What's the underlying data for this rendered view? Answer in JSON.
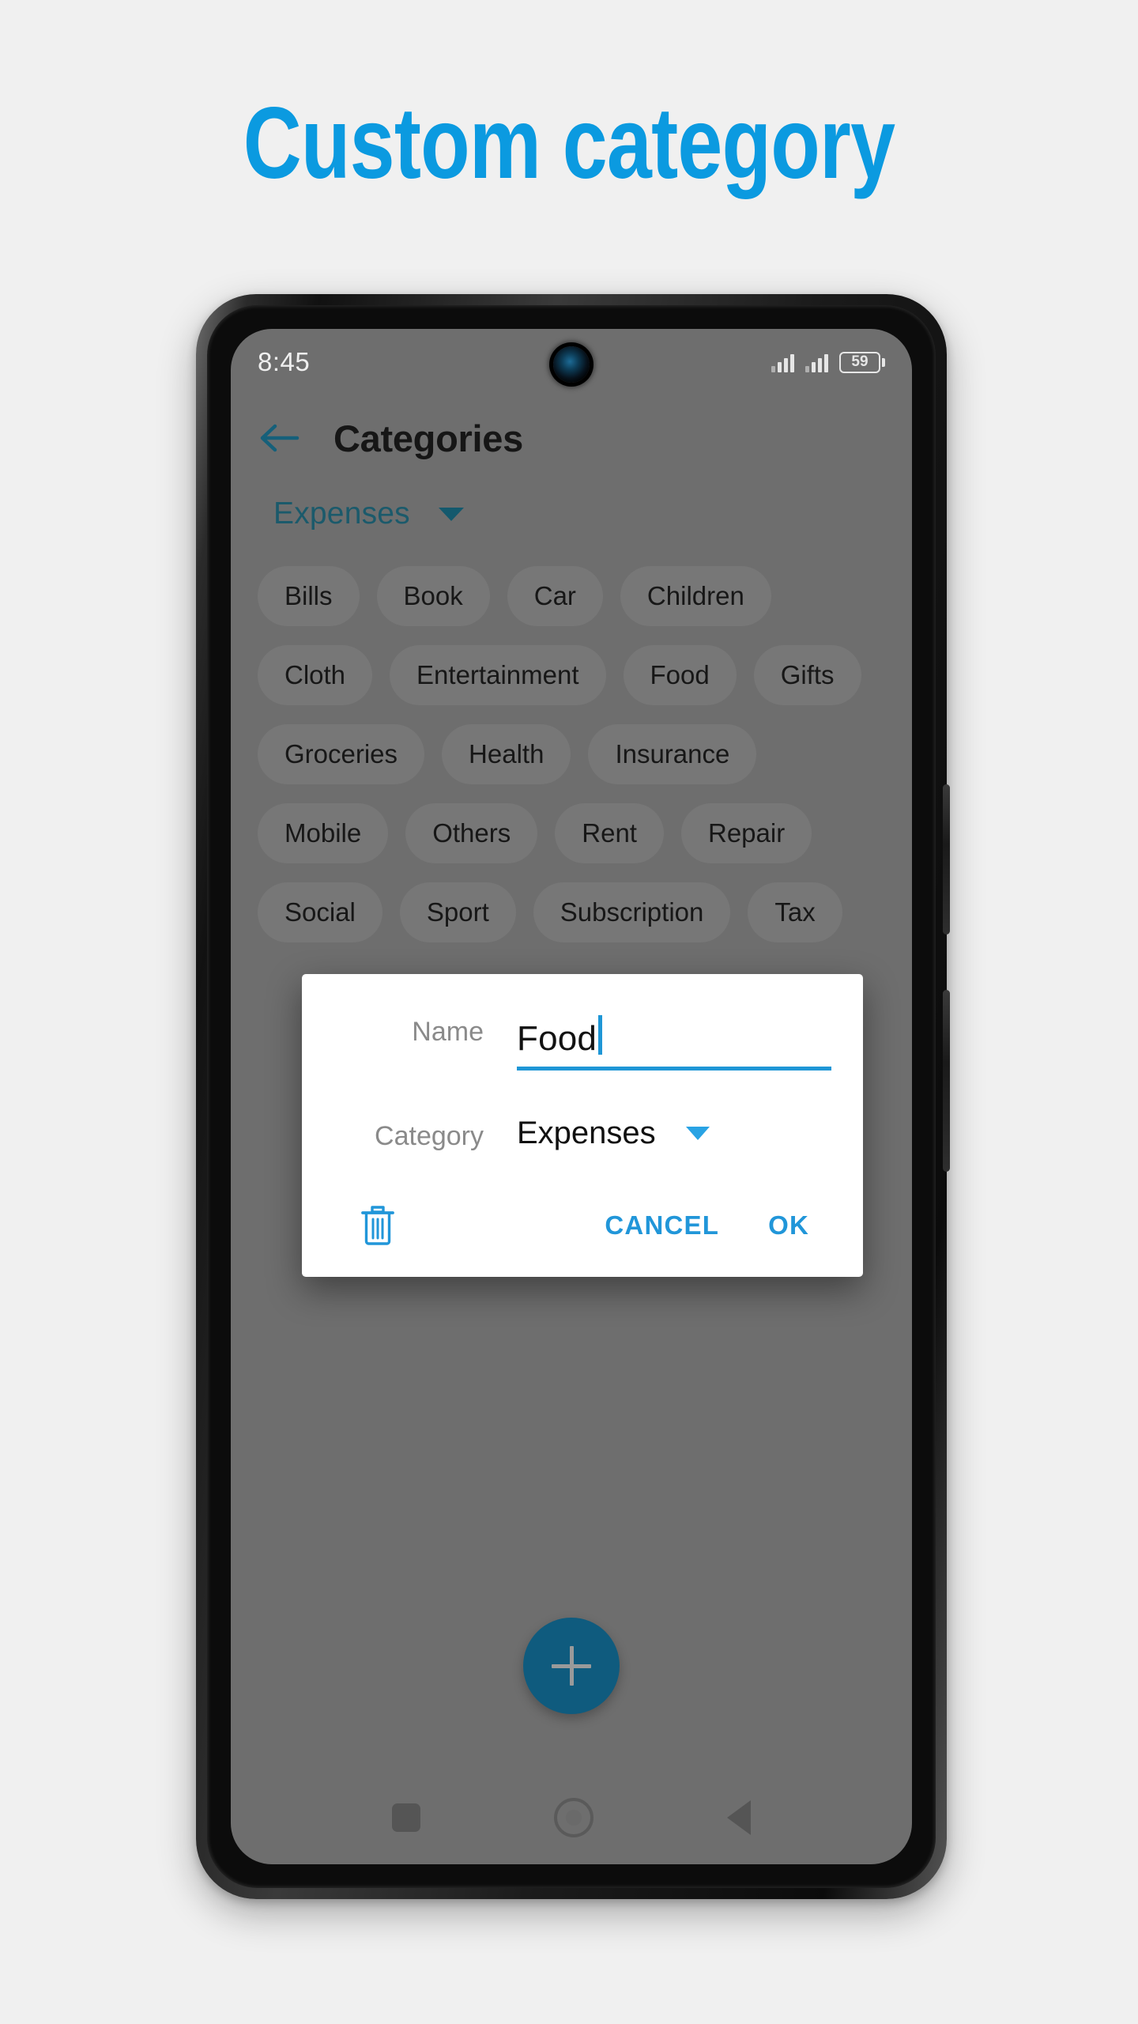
{
  "headline": {
    "text": "Custom category",
    "color": "#0b9ae0"
  },
  "status_bar": {
    "time": "8:45",
    "battery_percent": "59",
    "signal_icon": "signal-bars-icon",
    "camera_icon": "front-camera-icon"
  },
  "app_bar": {
    "back_icon": "back-arrow-icon",
    "title": "Categories"
  },
  "type_selector": {
    "label": "Expenses",
    "caret_icon": "chevron-down-icon"
  },
  "chips": [
    "Bills",
    "Book",
    "Car",
    "Children",
    "Cloth",
    "Entertainment",
    "Food",
    "Gifts",
    "Groceries",
    "Health",
    "Insurance",
    "Mobile",
    "Others",
    "Rent",
    "Repair",
    "Social",
    "Sport",
    "Subscription",
    "Tax"
  ],
  "dialog": {
    "name_label": "Name",
    "name_value": "Food",
    "name_placeholder": "Name",
    "category_label": "Category",
    "category_value": "Expenses",
    "category_caret_icon": "chevron-down-icon",
    "delete_icon": "trash-icon",
    "cancel_label": "CANCEL",
    "ok_label": "OK",
    "accent_color": "#2196d9"
  },
  "fab": {
    "icon": "plus-icon",
    "color": "#0f5b7e"
  },
  "nav_bar": {
    "recents_icon": "square-recents-icon",
    "home_icon": "circle-home-icon",
    "back_icon": "triangle-back-icon"
  }
}
